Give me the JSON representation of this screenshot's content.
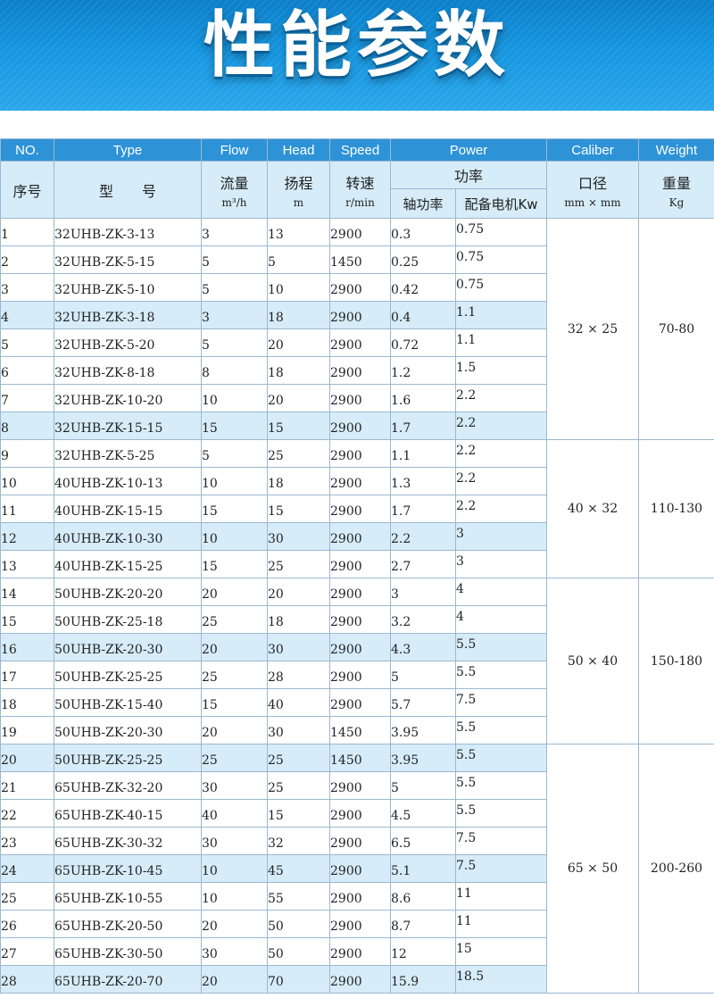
{
  "banner": {
    "title": "性能参数"
  },
  "header_en": {
    "no": "NO.",
    "type": "Type",
    "flow": "Flow",
    "head": "Head",
    "speed": "Speed",
    "power": "Power",
    "caliber": "Caliber",
    "weight": "Weight"
  },
  "header_cn": {
    "no": "序号",
    "type": "型　　号",
    "flow": "流量",
    "flow_unit": "m³/h",
    "head": "扬程",
    "head_unit": "m",
    "speed": "转速",
    "speed_unit": "r/min",
    "power": "功率",
    "shaft_power": "轴功率",
    "motor_power": "配备电机Kw",
    "caliber": "口径",
    "caliber_unit": "mm × mm",
    "weight": "重量",
    "weight_unit": "Kg"
  },
  "groups": [
    {
      "caliber": "32 × 25",
      "weight": "70-80"
    },
    {
      "caliber": "40 × 32",
      "weight": "110-130"
    },
    {
      "caliber": "50 × 40",
      "weight": "150-180"
    },
    {
      "caliber": "65 × 50",
      "weight": "200-260"
    }
  ],
  "rows": [
    {
      "no": "1",
      "type": "32UHB-ZK-3-13",
      "flow": "3",
      "head": "13",
      "speed": "2900",
      "shaft": "0.3",
      "motor": "0.75"
    },
    {
      "no": "2",
      "type": "32UHB-ZK-5-15",
      "flow": "5",
      "head": "5",
      "speed": "1450",
      "shaft": "0.25",
      "motor": "0.75"
    },
    {
      "no": "3",
      "type": "32UHB-ZK-5-10",
      "flow": "5",
      "head": "10",
      "speed": "2900",
      "shaft": "0.42",
      "motor": "0.75"
    },
    {
      "no": "4",
      "type": "32UHB-ZK-3-18",
      "flow": "3",
      "head": "18",
      "speed": "2900",
      "shaft": "0.4",
      "motor": "1.1"
    },
    {
      "no": "5",
      "type": "32UHB-ZK-5-20",
      "flow": "5",
      "head": "20",
      "speed": "2900",
      "shaft": "0.72",
      "motor": "1.1"
    },
    {
      "no": "6",
      "type": "32UHB-ZK-8-18",
      "flow": "8",
      "head": "18",
      "speed": "2900",
      "shaft": "1.2",
      "motor": "1.5"
    },
    {
      "no": "7",
      "type": "32UHB-ZK-10-20",
      "flow": "10",
      "head": "20",
      "speed": "2900",
      "shaft": "1.6",
      "motor": "2.2"
    },
    {
      "no": "8",
      "type": "32UHB-ZK-15-15",
      "flow": "15",
      "head": "15",
      "speed": "2900",
      "shaft": "1.7",
      "motor": "2.2"
    },
    {
      "no": "9",
      "type": "32UHB-ZK-5-25",
      "flow": "5",
      "head": "25",
      "speed": "2900",
      "shaft": "1.1",
      "motor": "2.2"
    },
    {
      "no": "10",
      "type": "40UHB-ZK-10-13",
      "flow": "10",
      "head": "18",
      "speed": "2900",
      "shaft": "1.3",
      "motor": "2.2"
    },
    {
      "no": "11",
      "type": "40UHB-ZK-15-15",
      "flow": "15",
      "head": "15",
      "speed": "2900",
      "shaft": "1.7",
      "motor": "2.2"
    },
    {
      "no": "12",
      "type": "40UHB-ZK-10-30",
      "flow": "10",
      "head": "30",
      "speed": "2900",
      "shaft": "2.2",
      "motor": "3"
    },
    {
      "no": "13",
      "type": "40UHB-ZK-15-25",
      "flow": "15",
      "head": "25",
      "speed": "2900",
      "shaft": "2.7",
      "motor": "3"
    },
    {
      "no": "14",
      "type": "50UHB-ZK-20-20",
      "flow": "20",
      "head": "20",
      "speed": "2900",
      "shaft": "3",
      "motor": "4"
    },
    {
      "no": "15",
      "type": "50UHB-ZK-25-18",
      "flow": "25",
      "head": "18",
      "speed": "2900",
      "shaft": "3.2",
      "motor": "4"
    },
    {
      "no": "16",
      "type": "50UHB-ZK-20-30",
      "flow": "20",
      "head": "30",
      "speed": "2900",
      "shaft": "4.3",
      "motor": "5.5"
    },
    {
      "no": "17",
      "type": "50UHB-ZK-25-25",
      "flow": "25",
      "head": "28",
      "speed": "2900",
      "shaft": "5",
      "motor": "5.5"
    },
    {
      "no": "18",
      "type": "50UHB-ZK-15-40",
      "flow": "15",
      "head": "40",
      "speed": "2900",
      "shaft": "5.7",
      "motor": "7.5"
    },
    {
      "no": "19",
      "type": "50UHB-ZK-20-30",
      "flow": "20",
      "head": "30",
      "speed": "1450",
      "shaft": "3.95",
      "motor": "5.5"
    },
    {
      "no": "20",
      "type": "50UHB-ZK-25-25",
      "flow": "25",
      "head": "25",
      "speed": "1450",
      "shaft": "3.95",
      "motor": "5.5"
    },
    {
      "no": "21",
      "type": "65UHB-ZK-32-20",
      "flow": "30",
      "head": "25",
      "speed": "2900",
      "shaft": "5",
      "motor": "5.5"
    },
    {
      "no": "22",
      "type": "65UHB-ZK-40-15",
      "flow": "40",
      "head": "15",
      "speed": "2900",
      "shaft": "4.5",
      "motor": "5.5"
    },
    {
      "no": "23",
      "type": "65UHB-ZK-30-32",
      "flow": "30",
      "head": "32",
      "speed": "2900",
      "shaft": "6.5",
      "motor": "7.5"
    },
    {
      "no": "24",
      "type": "65UHB-ZK-10-45",
      "flow": "10",
      "head": "45",
      "speed": "2900",
      "shaft": "5.1",
      "motor": "7.5"
    },
    {
      "no": "25",
      "type": "65UHB-ZK-10-55",
      "flow": "10",
      "head": "55",
      "speed": "2900",
      "shaft": "8.6",
      "motor": "11"
    },
    {
      "no": "26",
      "type": "65UHB-ZK-20-50",
      "flow": "20",
      "head": "50",
      "speed": "2900",
      "shaft": "8.7",
      "motor": "11"
    },
    {
      "no": "27",
      "type": "65UHB-ZK-30-50",
      "flow": "30",
      "head": "50",
      "speed": "2900",
      "shaft": "12",
      "motor": "15"
    },
    {
      "no": "28",
      "type": "65UHB-ZK-20-70",
      "flow": "20",
      "head": "70",
      "speed": "2900",
      "shaft": "15.9",
      "motor": "18.5"
    }
  ]
}
